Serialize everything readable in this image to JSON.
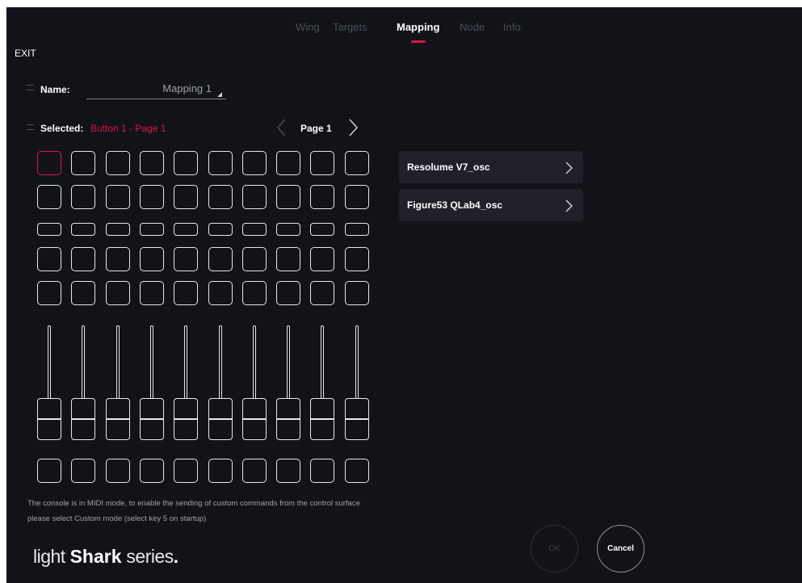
{
  "nav": {
    "tabs": [
      {
        "label": "Wing",
        "active": false
      },
      {
        "label": "Targets",
        "active": false
      },
      {
        "label": "Mapping",
        "active": true
      },
      {
        "label": "Node",
        "active": false
      },
      {
        "label": "Info",
        "active": false
      }
    ]
  },
  "exit_label": "EXIT",
  "name": {
    "label": "Name:",
    "value": "Mapping 1"
  },
  "selected": {
    "label": "Selected:",
    "value": "Button 1 - Page 1"
  },
  "pager": {
    "label": "Page 1"
  },
  "surface": {
    "columns": 10,
    "pad_rows": 5,
    "faders": 10,
    "bottom_buttons": 10,
    "selected_pad": "Button 1"
  },
  "targets": [
    {
      "label": "Resolume V7_osc"
    },
    {
      "label": "Figure53 QLab4_osc"
    }
  ],
  "note": "The console is in MIDI mode, to enable the sending of custom commands from the control surface please select Custom mode (select key 5 on startup)",
  "logo": {
    "part1": "light ",
    "part2": "Shark",
    "part3": " series",
    "dot": "."
  },
  "buttons": {
    "ok": "OK",
    "cancel": "Cancel"
  },
  "colors": {
    "accent": "#e0124a",
    "background": "#121318",
    "panel": "#1f2029"
  }
}
